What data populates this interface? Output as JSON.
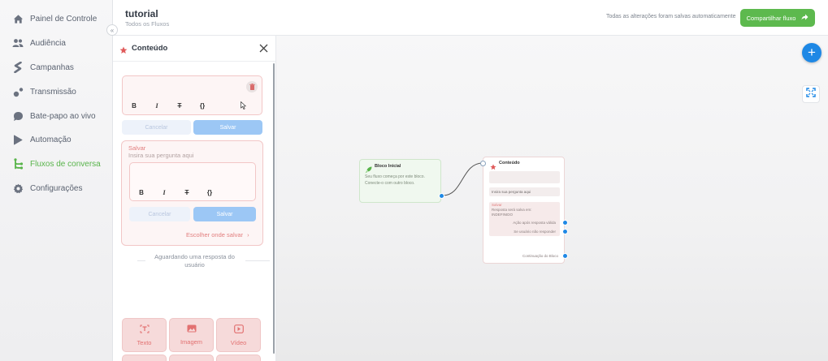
{
  "sidebar": {
    "items": [
      {
        "label": "Painel de Controle",
        "icon": "home-icon"
      },
      {
        "label": "Audiência",
        "icon": "users-icon"
      },
      {
        "label": "Campanhas",
        "icon": "campaigns-icon"
      },
      {
        "label": "Transmissão",
        "icon": "broadcast-icon"
      },
      {
        "label": "Bate-papo ao vivo",
        "icon": "chat-icon"
      },
      {
        "label": "Automação",
        "icon": "automation-icon"
      },
      {
        "label": "Fluxos de conversa",
        "icon": "flow-icon",
        "active": true
      },
      {
        "label": "Configurações",
        "icon": "gear-icon"
      }
    ],
    "collapse_glyph": "«"
  },
  "header": {
    "title": "tutorial",
    "subtitle": "Todos os Fluxos",
    "autosave_text": "Todas as alterações foram salvas automaticamente",
    "share_label": "Compartilhar fluxo"
  },
  "panel": {
    "title": "Conteúdo",
    "format_buttons": [
      "B",
      "I",
      "T",
      "{}"
    ],
    "cancel_label": "Cancelar",
    "save_label": "Salvar",
    "question": {
      "label": "Salvar",
      "placeholder": "Insira sua pergunta aqui",
      "choose_save": "Escolher onde salvar",
      "cancel_label": "Cancelar",
      "save_label": "Salvar"
    },
    "waiting_text": "Aguardando uma resposta do usuário",
    "types": [
      {
        "label": "Texto",
        "icon": "text-icon"
      },
      {
        "label": "Imagem",
        "icon": "image-icon"
      },
      {
        "label": "Vídeo",
        "icon": "video-icon"
      }
    ]
  },
  "canvas": {
    "start_node": {
      "title": "Bloco Inicial",
      "text": "Seu fluxo começa por este bloco. Conecte-o com outro bloco."
    },
    "content_node": {
      "title": "Conteúdo",
      "question_text": "Insira sua pergunta aqui",
      "save_label": "Salvar",
      "save_text": "Resposta será salva em: INDEFINIDO",
      "out_valid": "Ação após resposta válida",
      "out_no_reply": "Se usuário não responder",
      "continuation": "Continuação do Bloco"
    }
  },
  "colors": {
    "accent_green": "#5db94e",
    "accent_blue": "#1e88e5",
    "content_red": "#e27e7e"
  }
}
